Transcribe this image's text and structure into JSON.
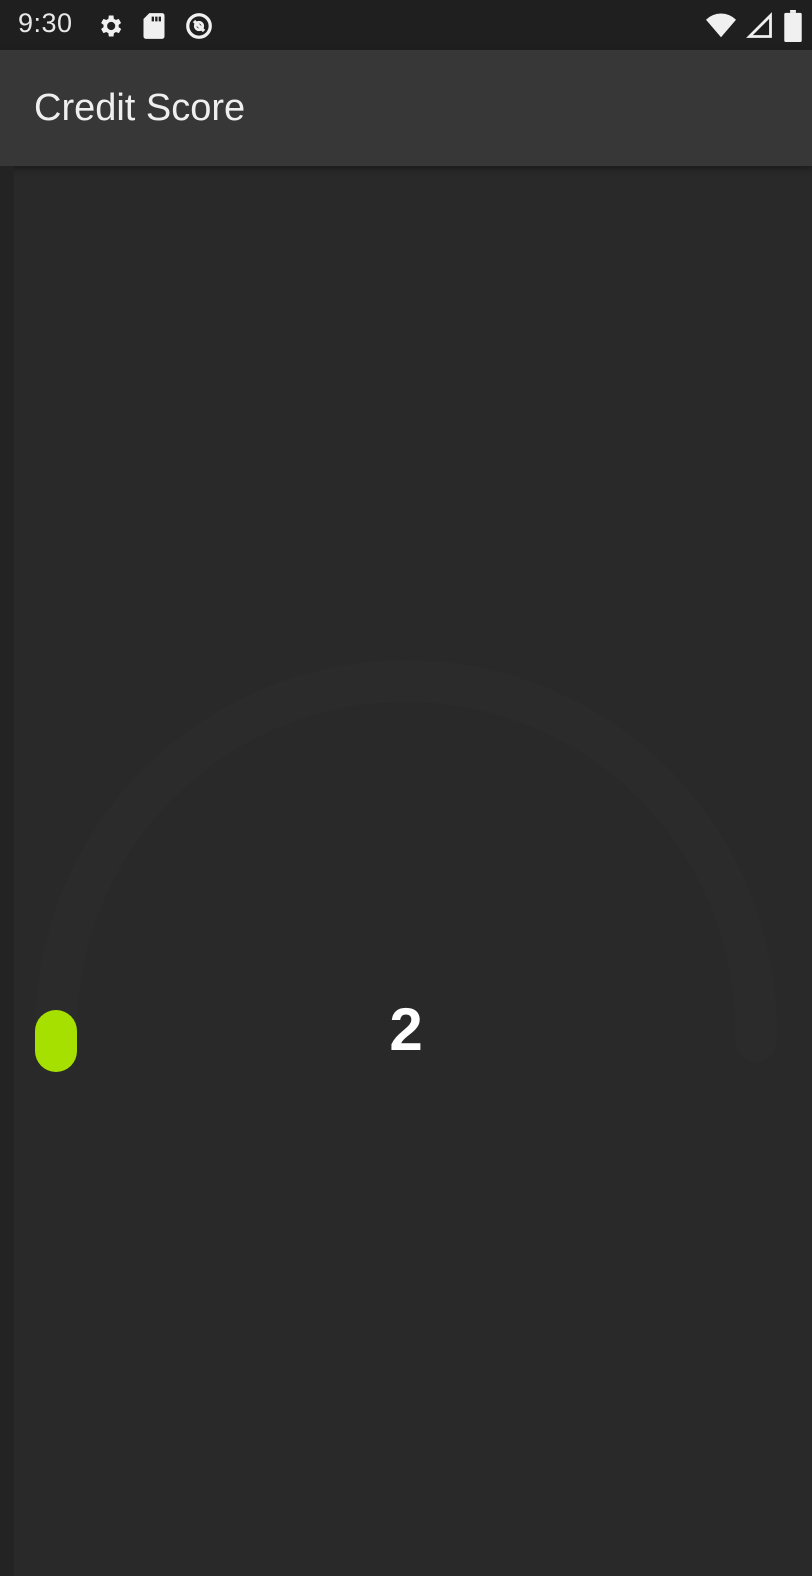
{
  "status_bar": {
    "time": "9:30",
    "left_icons": [
      "settings-icon",
      "sd-card-icon",
      "data-saver-icon"
    ],
    "right_icons": [
      "wifi-icon",
      "cell-signal-icon",
      "battery-icon"
    ]
  },
  "app_bar": {
    "title": "Credit Score"
  },
  "gauge": {
    "score": "2",
    "progress_fraction": 0.0,
    "colors": {
      "track": "#2b2b2b",
      "progress": "#a6e000",
      "score_text": "#ffffff"
    }
  }
}
